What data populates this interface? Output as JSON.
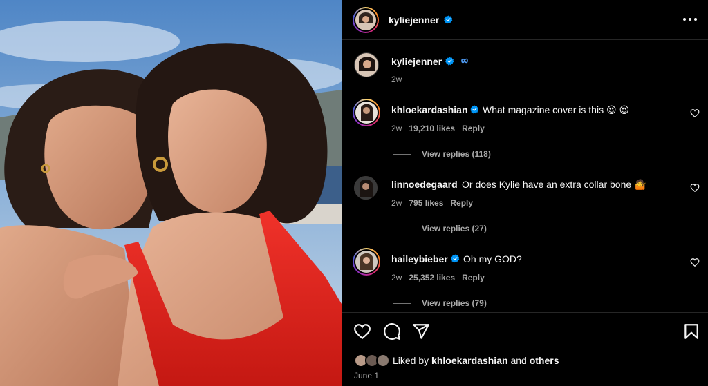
{
  "header": {
    "username": "kyliejenner"
  },
  "caption": {
    "username": "kyliejenner",
    "time": "2w"
  },
  "comments": [
    {
      "username": "khloekardashian",
      "text": "What magazine cover is this 😍 😍",
      "time": "2w",
      "likes": "19,210 likes",
      "reply": "Reply",
      "view_replies": "View replies (118)"
    },
    {
      "username": "linnoedegaard",
      "text": "Or does Kylie have an extra collar bone 🤷",
      "time": "2w",
      "likes": "795 likes",
      "reply": "Reply",
      "view_replies": "View replies (27)"
    },
    {
      "username": "haileybieber",
      "text": "Oh my GOD?",
      "time": "2w",
      "likes": "25,352 likes",
      "reply": "Reply",
      "view_replies": "View replies (79)"
    }
  ],
  "likes": {
    "prefix": "Liked by",
    "user": "khloekardashian",
    "and": "and",
    "others": "others"
  },
  "date": "June 1",
  "icons": {
    "more": "more-horizontal-icon",
    "verified": "verified-badge-icon",
    "threads": "threads-icon",
    "heart": "heart-icon",
    "comment": "comment-icon",
    "share": "share-icon",
    "save": "bookmark-icon"
  },
  "colors": {
    "background": "#000000",
    "verified": "#0095f6",
    "secondary_text": "#a8a8a8",
    "dress_red": "#e0241f"
  }
}
